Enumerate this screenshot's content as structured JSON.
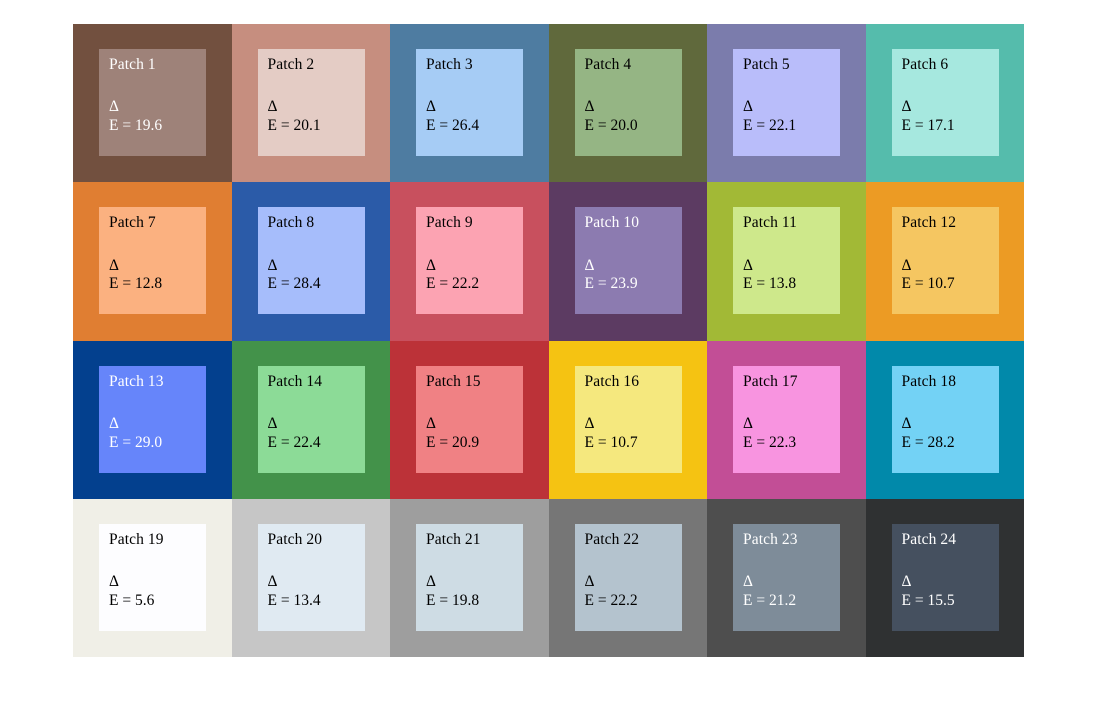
{
  "figure": {
    "type": "color-patch-grid",
    "rows": 4,
    "columns": 6,
    "background": "#ffffff",
    "delta_symbol": "Δ"
  },
  "chart_data": {
    "type": "table",
    "title": "",
    "xlabel": "",
    "ylabel": "",
    "description": "4x6 grid of 24 color patches; each cell shows an outer reference color swatch with an inner comparison swatch labelled with its patch number and CIE Delta-E value.",
    "columns": [
      "patch",
      "delta_e",
      "outer_color",
      "inner_color",
      "text_color"
    ],
    "categories": [
      "Patch 1",
      "Patch 2",
      "Patch 3",
      "Patch 4",
      "Patch 5",
      "Patch 6",
      "Patch 7",
      "Patch 8",
      "Patch 9",
      "Patch 10",
      "Patch 11",
      "Patch 12",
      "Patch 13",
      "Patch 14",
      "Patch 15",
      "Patch 16",
      "Patch 17",
      "Patch 18",
      "Patch 19",
      "Patch 20",
      "Patch 21",
      "Patch 22",
      "Patch 23",
      "Patch 24"
    ],
    "values": [
      19.6,
      20.1,
      26.4,
      20.0,
      22.1,
      17.1,
      12.8,
      28.4,
      22.2,
      23.9,
      13.8,
      10.7,
      29.0,
      22.4,
      20.9,
      10.7,
      22.3,
      28.2,
      5.6,
      13.4,
      19.8,
      22.2,
      21.2,
      15.5
    ]
  },
  "patches": [
    {
      "id": 1,
      "title": "Patch 1",
      "delta_symbol": "Δ",
      "delta_label": "E = 19.6",
      "delta_e": 19.6,
      "outer_color": "#72503F",
      "inner_color": "#9E8279",
      "text_color": "#FFFFFF"
    },
    {
      "id": 2,
      "title": "Patch 2",
      "delta_symbol": "Δ",
      "delta_label": "E = 20.1",
      "delta_e": 20.1,
      "outer_color": "#C68E7F",
      "inner_color": "#E4CCC5",
      "text_color": "#000000"
    },
    {
      "id": 3,
      "title": "Patch 3",
      "delta_symbol": "Δ",
      "delta_label": "E = 26.4",
      "delta_e": 26.4,
      "outer_color": "#4E7CA1",
      "inner_color": "#A6CCF5",
      "text_color": "#000000"
    },
    {
      "id": 4,
      "title": "Patch 4",
      "delta_symbol": "Δ",
      "delta_label": "E = 20.0",
      "delta_e": 20.0,
      "outer_color": "#60693C",
      "inner_color": "#95B584",
      "text_color": "#000000"
    },
    {
      "id": 5,
      "title": "Patch 5",
      "delta_symbol": "Δ",
      "delta_label": "E = 22.1",
      "delta_e": 22.1,
      "outer_color": "#7B7CAC",
      "inner_color": "#B9BDFA",
      "text_color": "#000000"
    },
    {
      "id": 6,
      "title": "Patch 6",
      "delta_symbol": "Δ",
      "delta_label": "E = 17.1",
      "delta_e": 17.1,
      "outer_color": "#55BCAC",
      "inner_color": "#A6E8DF",
      "text_color": "#000000"
    },
    {
      "id": 7,
      "title": "Patch 7",
      "delta_symbol": "Δ",
      "delta_label": "E = 12.8",
      "delta_e": 12.8,
      "outer_color": "#E07E32",
      "inner_color": "#FBB180",
      "text_color": "#000000"
    },
    {
      "id": 8,
      "title": "Patch 8",
      "delta_symbol": "Δ",
      "delta_label": "E = 28.4",
      "delta_e": 28.4,
      "outer_color": "#2B5BA8",
      "inner_color": "#A6BDFB",
      "text_color": "#000000"
    },
    {
      "id": 9,
      "title": "Patch 9",
      "delta_symbol": "Δ",
      "delta_label": "E = 22.2",
      "delta_e": 22.2,
      "outer_color": "#C8505E",
      "inner_color": "#FCA3B2",
      "text_color": "#000000"
    },
    {
      "id": 10,
      "title": "Patch 10",
      "delta_symbol": "Δ",
      "delta_label": "E = 23.9",
      "delta_e": 23.9,
      "outer_color": "#5C3B62",
      "inner_color": "#8C7BB0",
      "text_color": "#FFFFFF"
    },
    {
      "id": 11,
      "title": "Patch 11",
      "delta_symbol": "Δ",
      "delta_label": "E = 13.8",
      "delta_e": 13.8,
      "outer_color": "#A2B936",
      "inner_color": "#CEE88B",
      "text_color": "#000000"
    },
    {
      "id": 12,
      "title": "Patch 12",
      "delta_symbol": "Δ",
      "delta_label": "E = 10.7",
      "delta_e": 10.7,
      "outer_color": "#EC9B24",
      "inner_color": "#F5C661",
      "text_color": "#000000"
    },
    {
      "id": 13,
      "title": "Patch 13",
      "delta_symbol": "Δ",
      "delta_label": "E = 29.0",
      "delta_e": 29.0,
      "outer_color": "#03408E",
      "inner_color": "#6685FA",
      "text_color": "#FFFFFF"
    },
    {
      "id": 14,
      "title": "Patch 14",
      "delta_symbol": "Δ",
      "delta_label": "E = 22.4",
      "delta_e": 22.4,
      "outer_color": "#43924A",
      "inner_color": "#8CDB97",
      "text_color": "#000000"
    },
    {
      "id": 15,
      "title": "Patch 15",
      "delta_symbol": "Δ",
      "delta_label": "E = 20.9",
      "delta_e": 20.9,
      "outer_color": "#BC3238",
      "inner_color": "#F08184",
      "text_color": "#000000"
    },
    {
      "id": 16,
      "title": "Patch 16",
      "delta_symbol": "Δ",
      "delta_label": "E = 10.7",
      "delta_e": 10.7,
      "outer_color": "#F5C312",
      "inner_color": "#F5E87E",
      "text_color": "#000000"
    },
    {
      "id": 17,
      "title": "Patch 17",
      "delta_symbol": "Δ",
      "delta_label": "E = 22.3",
      "delta_e": 22.3,
      "outer_color": "#C24E96",
      "inner_color": "#F894E0",
      "text_color": "#000000"
    },
    {
      "id": 18,
      "title": "Patch 18",
      "delta_symbol": "Δ",
      "delta_label": "E = 28.2",
      "delta_e": 28.2,
      "outer_color": "#0189AA",
      "inner_color": "#73D2F5",
      "text_color": "#000000"
    },
    {
      "id": 19,
      "title": "Patch 19",
      "delta_symbol": "Δ",
      "delta_label": "E = 5.6",
      "delta_e": 5.6,
      "outer_color": "#F0EFE7",
      "inner_color": "#FDFDFF",
      "text_color": "#000000"
    },
    {
      "id": 20,
      "title": "Patch 20",
      "delta_symbol": "Δ",
      "delta_label": "E = 13.4",
      "delta_e": 13.4,
      "outer_color": "#C6C6C6",
      "inner_color": "#E0EAF2",
      "text_color": "#000000"
    },
    {
      "id": 21,
      "title": "Patch 21",
      "delta_symbol": "Δ",
      "delta_label": "E = 19.8",
      "delta_e": 19.8,
      "outer_color": "#9E9E9E",
      "inner_color": "#CEDCE4",
      "text_color": "#000000"
    },
    {
      "id": 22,
      "title": "Patch 22",
      "delta_symbol": "Δ",
      "delta_label": "E = 22.2",
      "delta_e": 22.2,
      "outer_color": "#767676",
      "inner_color": "#B4C3CE",
      "text_color": "#000000"
    },
    {
      "id": 23,
      "title": "Patch 23",
      "delta_symbol": "Δ",
      "delta_label": "E = 21.2",
      "delta_e": 21.2,
      "outer_color": "#4E4E4E",
      "inner_color": "#7E8C99",
      "text_color": "#FFFFFF"
    },
    {
      "id": 24,
      "title": "Patch 24",
      "delta_symbol": "Δ",
      "delta_label": "E = 15.5",
      "delta_e": 15.5,
      "outer_color": "#2F3132",
      "inner_color": "#45505F",
      "text_color": "#FFFFFF"
    }
  ]
}
